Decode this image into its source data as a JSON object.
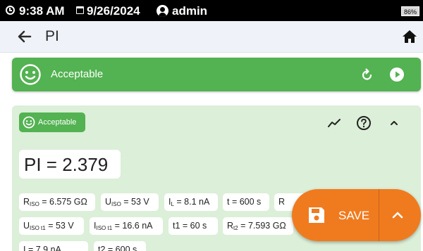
{
  "status_bar": {
    "time": "9:38 AM",
    "date": "9/26/2024",
    "user": "admin",
    "battery": "86%"
  },
  "header": {
    "title": "PI",
    "back_icon": "arrow-left-icon",
    "home_icon": "home-icon"
  },
  "result_banner": {
    "label": "Acceptable",
    "color": "#53b251",
    "icons": [
      "smiley-icon",
      "refresh-icon",
      "play-icon"
    ]
  },
  "detail_card": {
    "background": "#dcefd8",
    "status_chip": "Acceptable",
    "actions": [
      "trend-icon",
      "help-icon",
      "chevron-up-icon"
    ],
    "pi_value": "PI = 2.379",
    "params": [
      {
        "sym": "R",
        "sub": "ISO",
        "val": " = 6.575 GΩ"
      },
      {
        "sym": "U",
        "sub": "ISO",
        "val": " = 53 V"
      },
      {
        "sym": "I",
        "sub": "L",
        "val": " = 8.1 nA"
      },
      {
        "sym": "t",
        "sub": "",
        "val": " = 600 s"
      },
      {
        "sym": "R",
        "sub": "",
        "val": ""
      },
      {
        "sym": "U",
        "sub": "ISO t1",
        "val": " = 53 V"
      },
      {
        "sym": "I",
        "sub": "ISO t1",
        "val": " = 16.6 nA"
      },
      {
        "sym": "t1",
        "sub": "",
        "val": " = 60 s"
      },
      {
        "sym": "R",
        "sub": "t2",
        "val": " = 7.593 GΩ"
      },
      {
        "sym": "I",
        "sub": "",
        "val": " = 7.9 nA"
      },
      {
        "sym": "t2",
        "sub": "",
        "val": " = 600 s"
      }
    ]
  },
  "fab": {
    "save_label": "SAVE",
    "color": "#f07b1f",
    "icons": [
      "save-icon",
      "chevron-up-icon"
    ]
  }
}
